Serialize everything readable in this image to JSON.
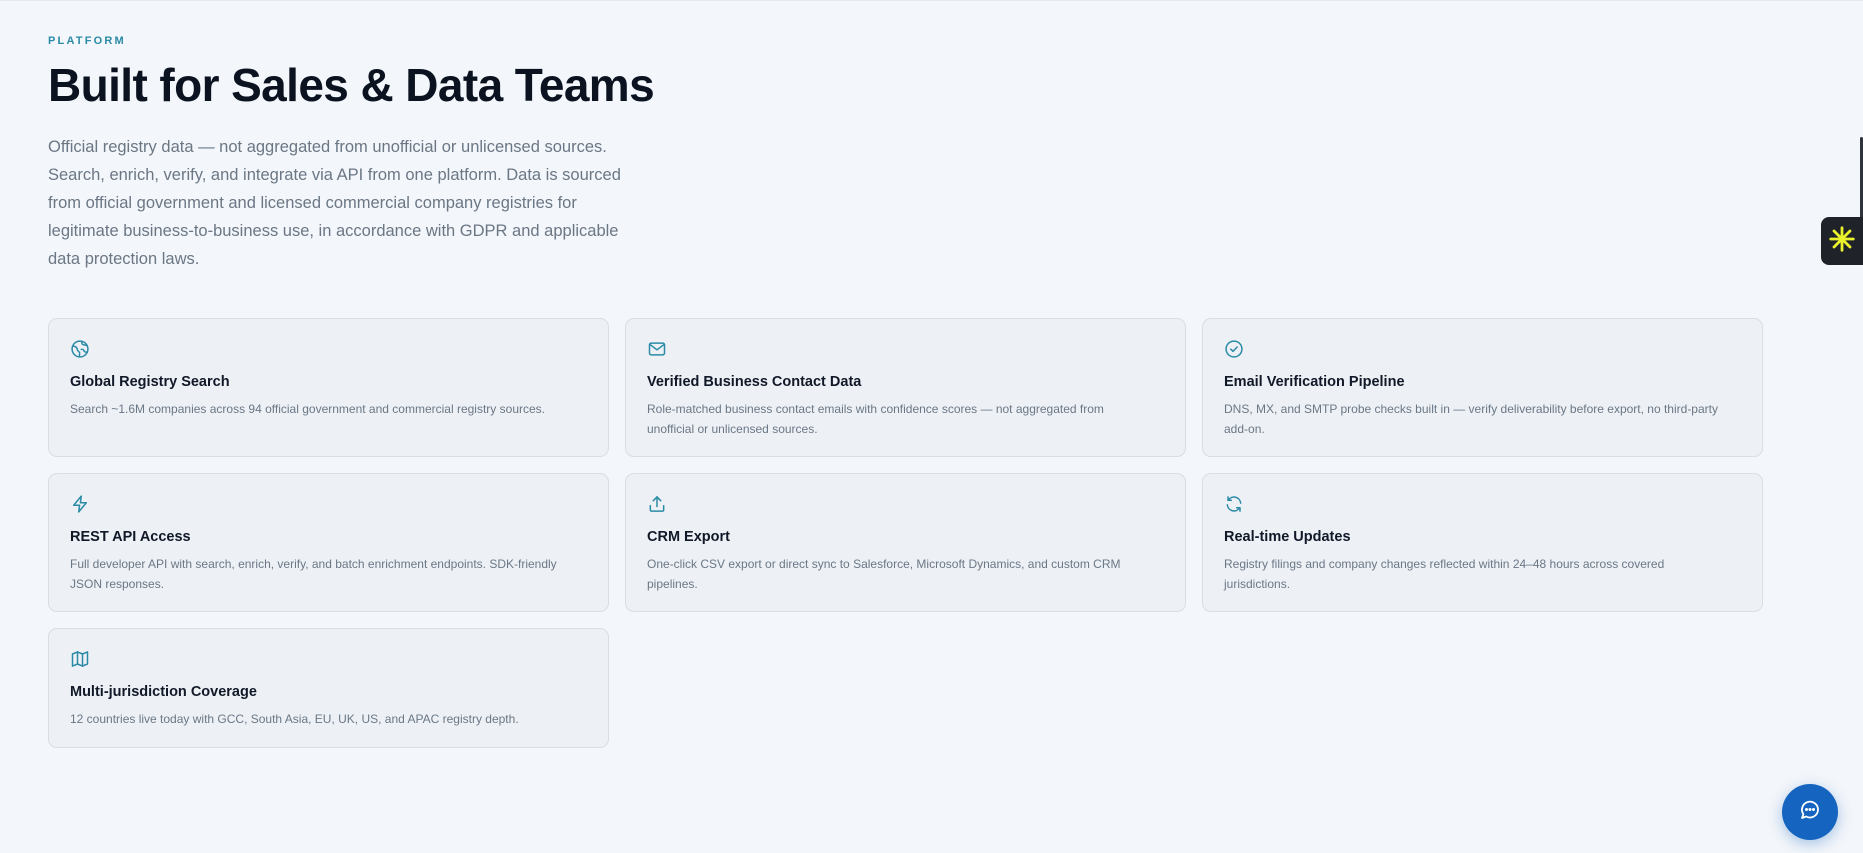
{
  "hero": {
    "eyebrow": "PLATFORM",
    "title": "Built for Sales & Data Teams",
    "description": "Official registry data — not aggregated from unofficial or unlicensed sources. Search, enrich, verify, and integrate via API from one platform. Data is sourced from official government and licensed commercial company registries for legitimate business-to-business use, in accordance with GDPR and applicable data protection laws."
  },
  "colors": {
    "accent": "#2b8aa6",
    "background": "#f3f6fa",
    "card_background": "#edf1f6",
    "chat_button": "#1565c0"
  },
  "features": [
    {
      "icon": "globe-icon",
      "title": "Global Registry Search",
      "text": "Search ~1.6M companies across 94 official government and commercial registry sources."
    },
    {
      "icon": "mail-icon",
      "title": "Verified Business Contact Data",
      "text": "Role-matched business contact emails with confidence scores — not aggregated from unofficial or unlicensed sources."
    },
    {
      "icon": "check-circle-icon",
      "title": "Email Verification Pipeline",
      "text": "DNS, MX, and SMTP probe checks built in — verify deliverability before export, no third-party add-on."
    },
    {
      "icon": "lightning-icon",
      "title": "REST API Access",
      "text": "Full developer API with search, enrich, verify, and batch enrichment endpoints. SDK-friendly JSON responses."
    },
    {
      "icon": "upload-icon",
      "title": "CRM Export",
      "text": "One-click CSV export or direct sync to Salesforce, Microsoft Dynamics, and custom CRM pipelines."
    },
    {
      "icon": "refresh-icon",
      "title": "Real-time Updates",
      "text": "Registry filings and company changes reflected within 24–48 hours across covered jurisdictions."
    },
    {
      "icon": "map-icon",
      "title": "Multi-jurisdiction Coverage",
      "text": "12 countries live today with GCC, South Asia, EU, UK, US, and APAC registry depth."
    }
  ],
  "widgets": {
    "side_widget_icon": "asterisk-icon",
    "chat_icon": "chat-bubble-icon"
  }
}
